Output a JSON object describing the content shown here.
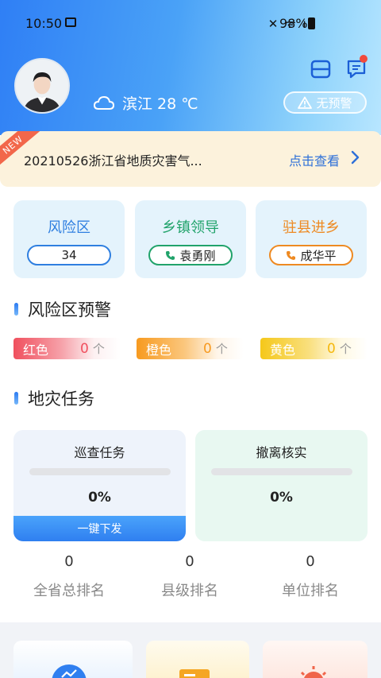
{
  "status_bar": {
    "time": "10:50",
    "icons": "✕ ᯤ ıll",
    "battery": "98%"
  },
  "header": {
    "weather": {
      "city_temp": "滨江 28 ℃",
      "icon": "cloud-icon"
    },
    "warning_badge": "无预警",
    "icons": [
      "scan-icon",
      "message-icon"
    ]
  },
  "notice": {
    "ribbon": "NEW",
    "text": "20210526浙江省地质灾害气...",
    "link": "点击查看"
  },
  "cards": [
    {
      "title": "风险区",
      "value": "34",
      "color": "#2f7fe0"
    },
    {
      "title": "乡镇领导",
      "value": "袁勇刚",
      "color": "#21a36b"
    },
    {
      "title": "驻县进乡",
      "value": "成华平",
      "color": "#ee8a22"
    }
  ],
  "sections": {
    "risk_warning": "风险区预警",
    "disaster_tasks": "地灾任务"
  },
  "levels": [
    {
      "name": "红色",
      "count": "0",
      "unit": "个",
      "color": "#f0505e"
    },
    {
      "name": "橙色",
      "count": "0",
      "unit": "个",
      "color": "#f79a1f"
    },
    {
      "name": "黄色",
      "count": "0",
      "unit": "个",
      "color": "#f5c81a"
    }
  ],
  "tasks": [
    {
      "title": "巡查任务",
      "percent": "0%",
      "progress": 0,
      "button": "一键下发"
    },
    {
      "title": "撤离核实",
      "percent": "0%",
      "progress": 0
    }
  ],
  "ranks": [
    {
      "value": "0",
      "label": "全省总排名"
    },
    {
      "value": "0",
      "label": "县级排名"
    },
    {
      "value": "0",
      "label": "单位排名"
    }
  ]
}
